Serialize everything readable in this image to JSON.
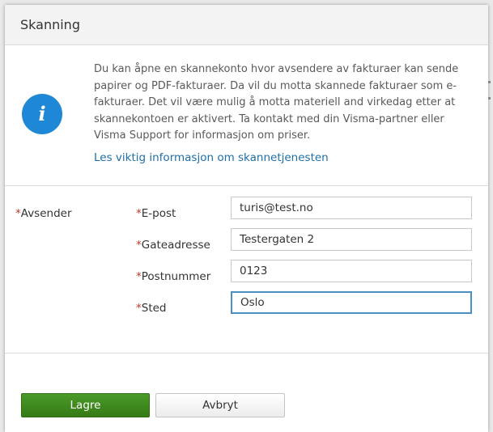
{
  "dialog": {
    "title": "Skanning"
  },
  "info": {
    "icon": "info-icon",
    "icon_glyph": "i",
    "icon_color": "#1e87d6",
    "text": "Du kan åpne en skannekonto hvor avsendere av fakturaer kan sende papirer og PDF-fakturaer. Da vil du motta skannede fakturaer som e-fakturaer. Det vil være mulig å motta materiell and virkedag etter at skannekontoen er aktivert. Ta kontakt med din Visma-partner eller Visma Support for informasjon om priser.",
    "link": "Les viktig informasjon om skannetjenesten"
  },
  "form": {
    "group_label": "Avsender",
    "required_marker": "*",
    "fields": [
      {
        "label": "E-post",
        "value": "turis@test.no"
      },
      {
        "label": "Gateadresse",
        "value": "Testergaten 2"
      },
      {
        "label": "Postnummer",
        "value": "0123"
      },
      {
        "label": "Sted",
        "value": "Oslo"
      }
    ]
  },
  "buttons": {
    "save_label": "Lagre",
    "cancel_label": "Avbryt"
  },
  "colors": {
    "primary_button": "#3f8a1f",
    "link": "#1f6fa6",
    "required": "#c0392b"
  }
}
